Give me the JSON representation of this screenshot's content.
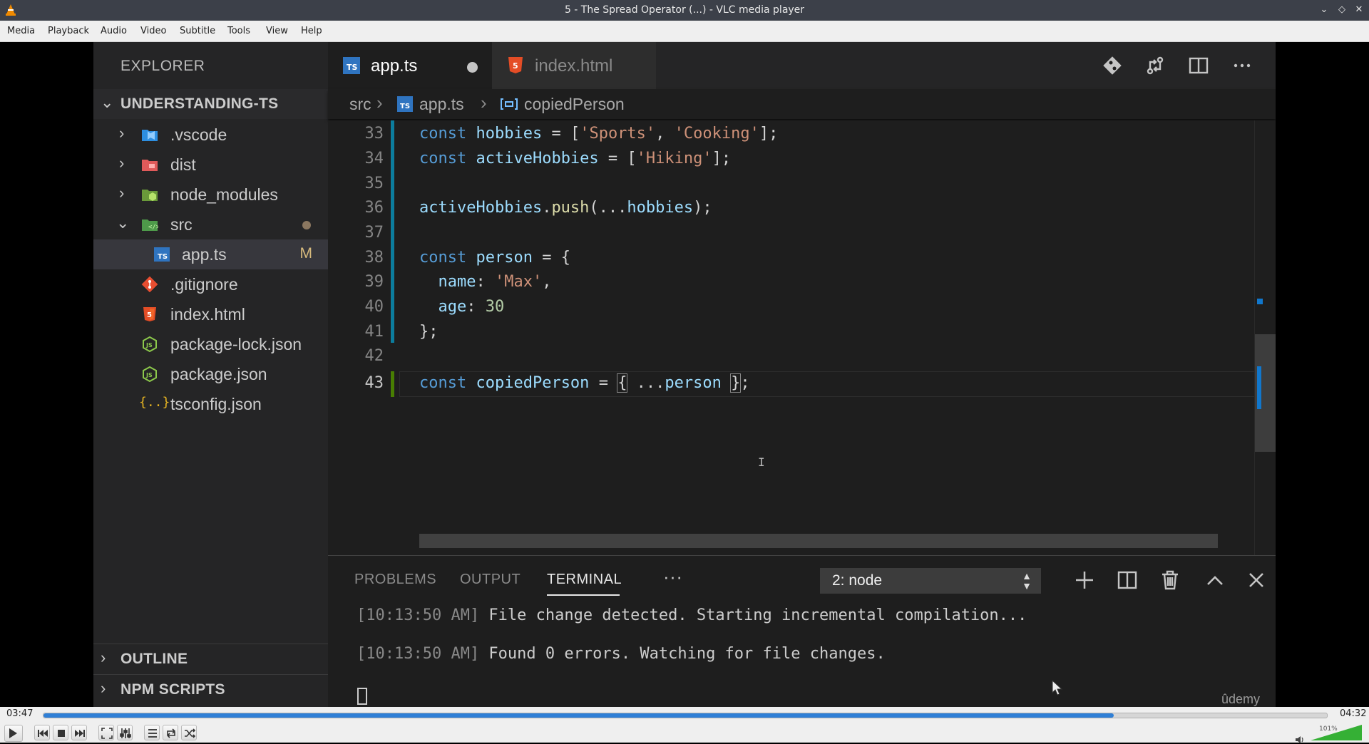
{
  "window": {
    "title": "5 - The Spread Operator (...) - VLC media player"
  },
  "menu": [
    "Media",
    "Playback",
    "Audio",
    "Video",
    "Subtitle",
    "Tools",
    "View",
    "Help"
  ],
  "vscode": {
    "explorer_title": "EXPLORER",
    "project": "UNDERSTANDING-TS",
    "tree": [
      {
        "name": ".vscode",
        "type": "folder",
        "expanded": false
      },
      {
        "name": "dist",
        "type": "folder",
        "expanded": false
      },
      {
        "name": "node_modules",
        "type": "folder",
        "expanded": false
      },
      {
        "name": "src",
        "type": "folder",
        "expanded": true
      },
      {
        "name": "app.ts",
        "type": "ts",
        "status": "M"
      },
      {
        "name": ".gitignore",
        "type": "git"
      },
      {
        "name": "index.html",
        "type": "html"
      },
      {
        "name": "package-lock.json",
        "type": "json"
      },
      {
        "name": "package.json",
        "type": "json"
      },
      {
        "name": "tsconfig.json",
        "type": "tsconfig"
      }
    ],
    "outline_label": "OUTLINE",
    "npm_label": "NPM SCRIPTS",
    "tabs": [
      {
        "name": "app.ts",
        "active": true,
        "modified": true
      },
      {
        "name": "index.html",
        "active": false
      }
    ],
    "breadcrumb": [
      "src",
      "app.ts",
      "copiedPerson"
    ],
    "code_lines": [
      {
        "num": "33",
        "text": "const hobbies = ['Sports', 'Cooking'];"
      },
      {
        "num": "34",
        "text": "const activeHobbies = ['Hiking'];"
      },
      {
        "num": "35",
        "text": ""
      },
      {
        "num": "36",
        "text": "activeHobbies.push(...hobbies);"
      },
      {
        "num": "37",
        "text": ""
      },
      {
        "num": "38",
        "text": "const person = {"
      },
      {
        "num": "39",
        "text": "  name: 'Max',"
      },
      {
        "num": "40",
        "text": "  age: 30"
      },
      {
        "num": "41",
        "text": "};"
      },
      {
        "num": "42",
        "text": ""
      },
      {
        "num": "43",
        "text": "const copiedPerson = { ...person };"
      }
    ],
    "panel_tabs": [
      "PROBLEMS",
      "OUTPUT",
      "TERMINAL"
    ],
    "panel_more": "···",
    "terminal_select": "2: node",
    "terminal_lines": [
      {
        "ts": "[10:13:50 AM]",
        "msg": " File change detected. Starting incremental compilation..."
      },
      {
        "ts": "[10:13:50 AM]",
        "msg": " Found 0 errors. Watching for file changes."
      }
    ],
    "watermark": "ûdemy"
  },
  "player": {
    "elapsed": "03:47",
    "total": "04:32",
    "progress": 0.834,
    "volume_label": "101%",
    "volume_level": 1.01,
    "accent": "#2f7fd6"
  },
  "colors": {
    "vscode_bg": "#1e1e1e",
    "sidebar_bg": "#252526",
    "keyword": "#569cd6",
    "variable": "#9cdcfe",
    "string": "#ce9178",
    "number": "#b5cea8",
    "function": "#dcdcaa"
  }
}
